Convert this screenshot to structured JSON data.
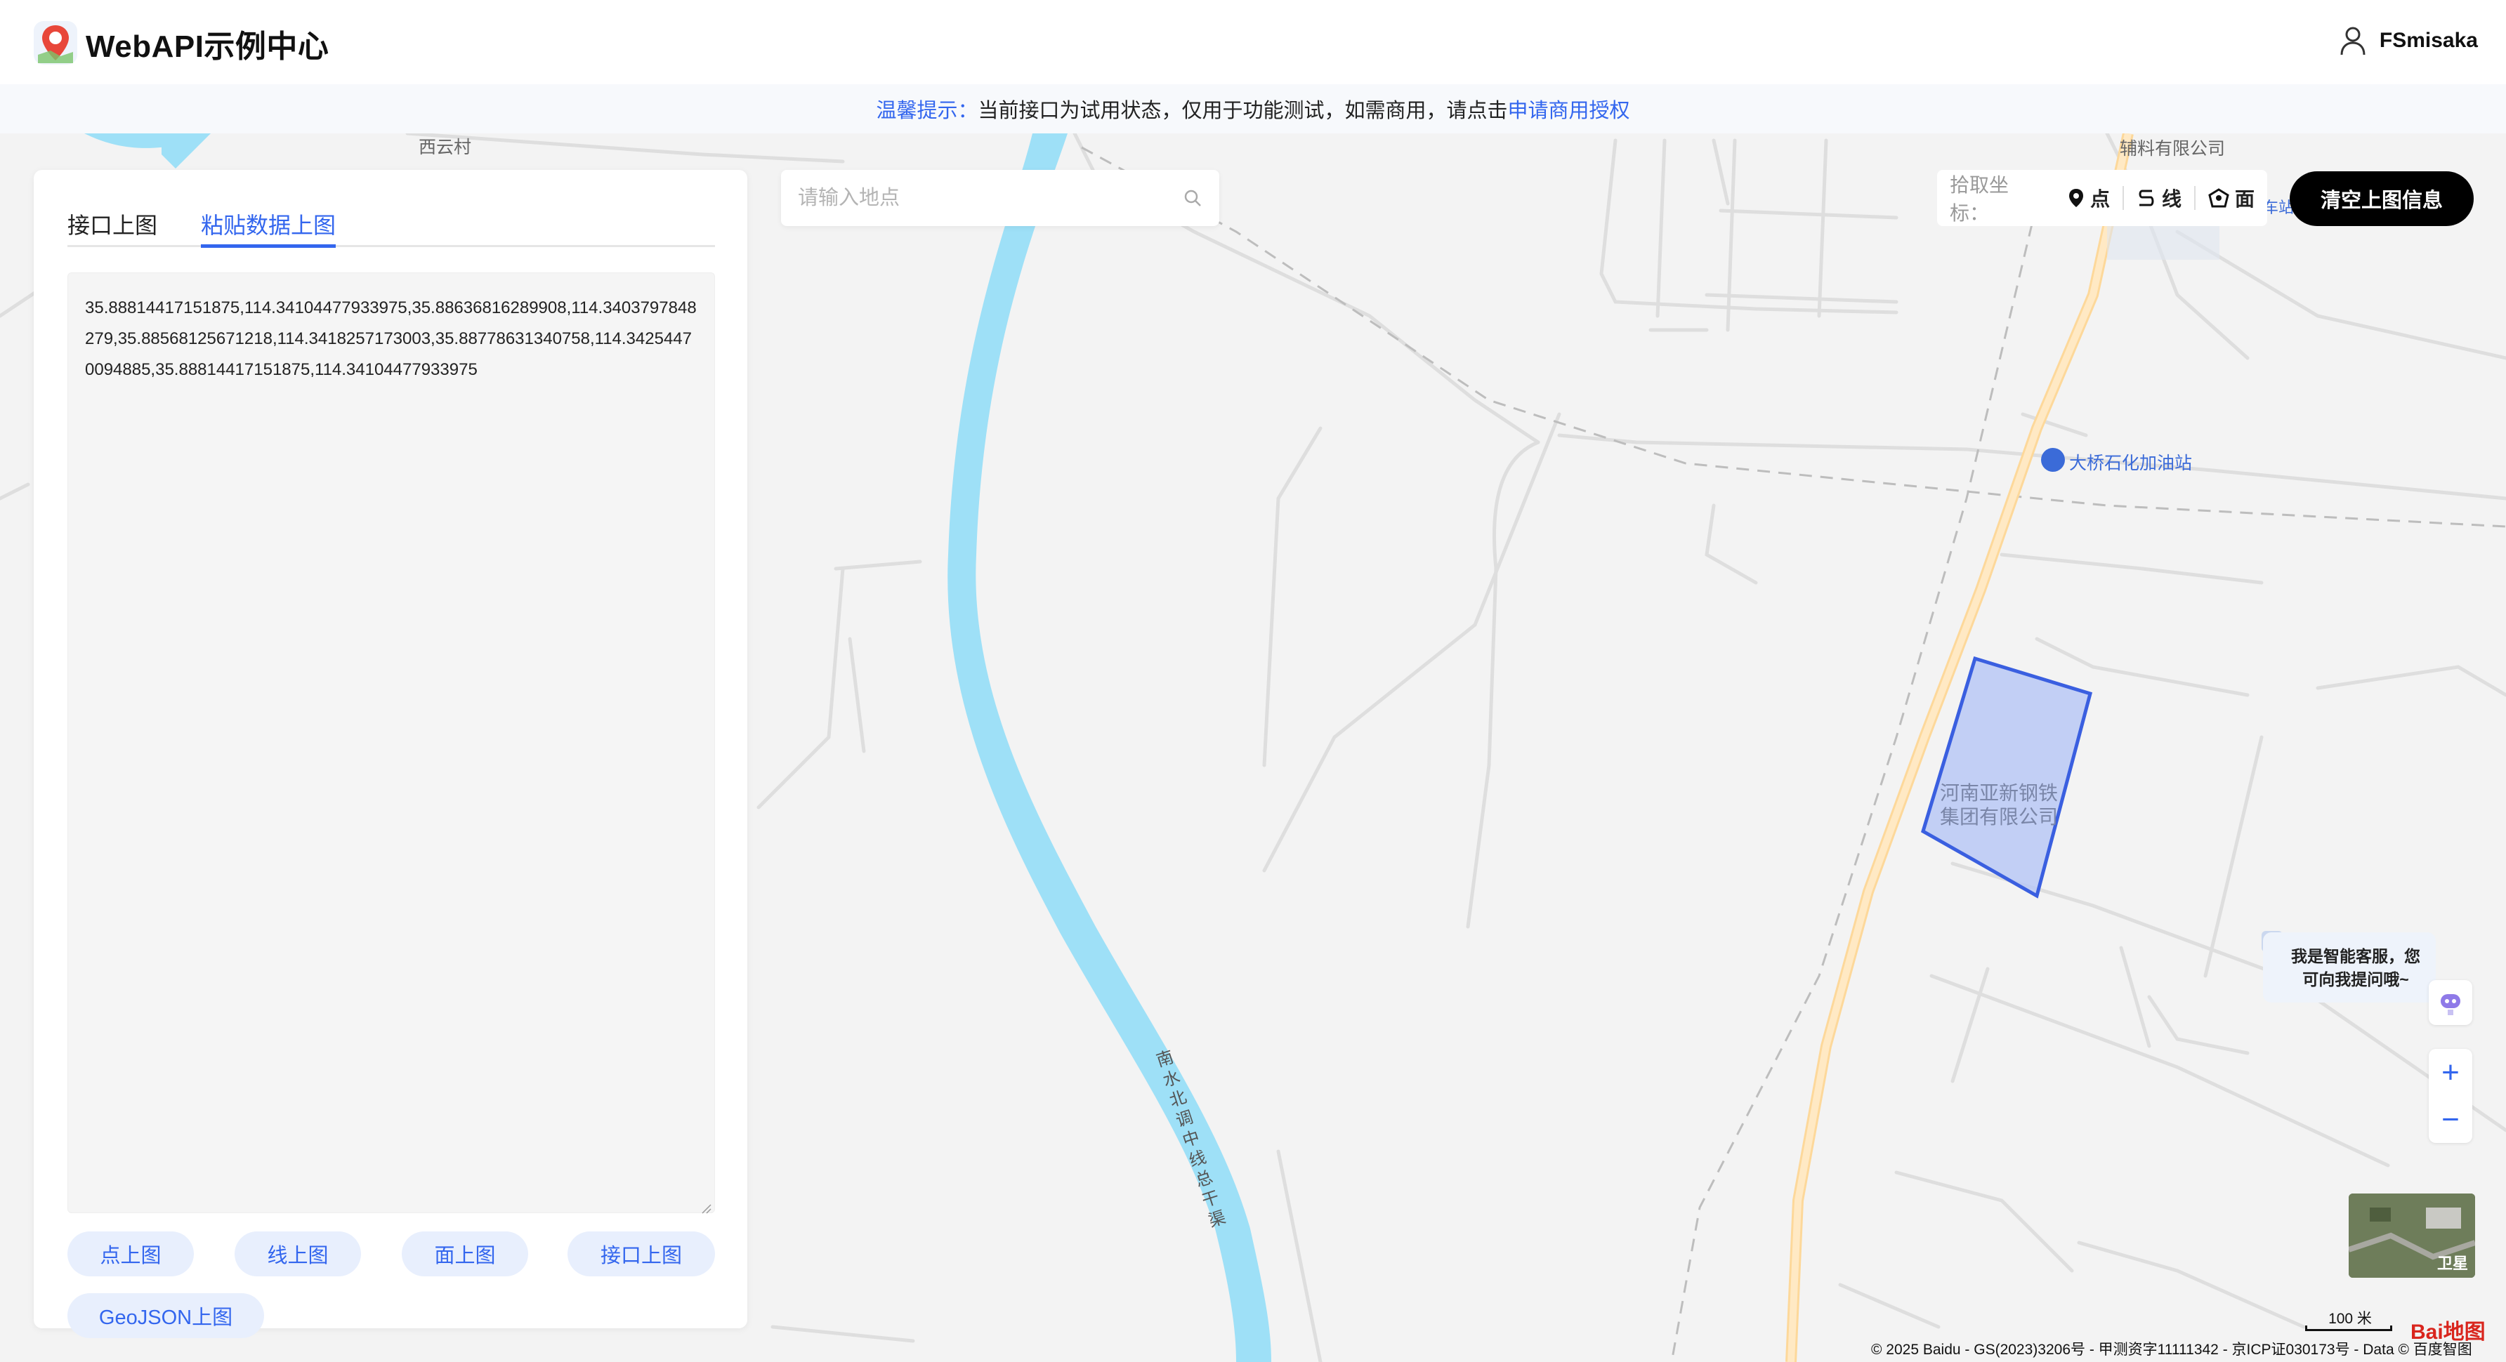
{
  "header": {
    "title": "WebAPI示例中心",
    "username": "FSmisaka"
  },
  "notice": {
    "hint": "温馨提示：",
    "text": "当前接口为试用状态，仅用于功能测试，如需商用，请点击",
    "link": "申请商用授权"
  },
  "panel": {
    "tabs": [
      {
        "label": "接口上图",
        "active": false
      },
      {
        "label": "粘贴数据上图",
        "active": true
      }
    ],
    "textarea_value": "35.88814417151875,114.34104477933975,35.88636816289908,114.3403797848279,35.88568125671218,114.3418257173003,35.88778631340758,114.34254470094885,35.88814417151875,114.34104477933975",
    "buttons": [
      "点上图",
      "线上图",
      "面上图",
      "接口上图",
      "GeoJSON上图"
    ]
  },
  "search": {
    "placeholder": "请输入地点"
  },
  "picker": {
    "label": "拾取坐标：",
    "point": "点",
    "line": "线",
    "polygon": "面"
  },
  "clear_button": "清空上图信息",
  "chat": {
    "line1": "我是智能客服，您",
    "line2": "可向我提问哦~",
    "close": "×"
  },
  "zoom": {
    "in": "+",
    "out": "−"
  },
  "satellite_label": "卫星",
  "scale_label": "100 米",
  "copyright": "© 2025 Baidu - GS(2023)3206号 - 甲测资字11111342 - 京ICP证030173号 - Data © 百度智图",
  "baidu_logo": "Bai地图",
  "map_labels": {
    "village": "西云村",
    "company_top": "辅料有限公司",
    "gas_station": "大桥石化加油站",
    "steel_company_1": "河南亚新钢铁",
    "steel_company_2": "集团有限公司",
    "canal": "南水北调中线总干渠",
    "station_fragment": "车站"
  },
  "colors": {
    "accent": "#3366ee",
    "river": "#9ee0f7",
    "highway": "#ffe3ad",
    "polygon_fill": "#b8c8f4",
    "polygon_stroke": "#3a5fe0"
  }
}
